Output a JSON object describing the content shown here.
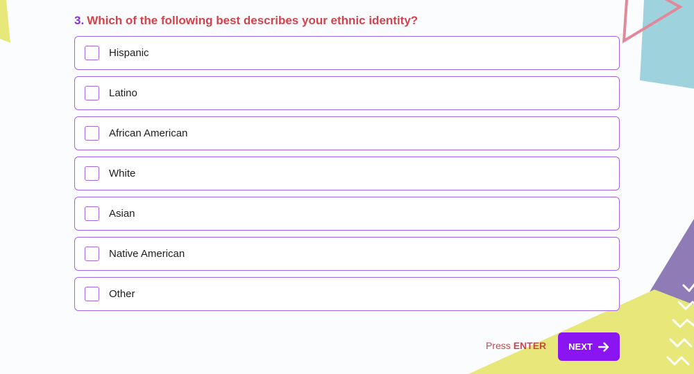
{
  "question": {
    "number": "3.",
    "text": "Which of the following best describes your ethnic identity?"
  },
  "options": [
    {
      "label": "Hispanic",
      "checked": false
    },
    {
      "label": "Latino",
      "checked": false
    },
    {
      "label": "African American",
      "checked": false
    },
    {
      "label": "White",
      "checked": false
    },
    {
      "label": "Asian",
      "checked": false
    },
    {
      "label": "Native American",
      "checked": false
    },
    {
      "label": "Other",
      "checked": false
    }
  ],
  "footer": {
    "hint_prefix": "Press",
    "hint_key": "ENTER",
    "next_label": "NEXT",
    "next_icon": "arrow-right-icon"
  },
  "colors": {
    "accent": "#8a14f2",
    "option_border": "#a464e6",
    "question_text": "#d2434c",
    "shape_yellow": "#e8e77a",
    "shape_blue": "#9ed3de",
    "shape_pink": "#e0899a",
    "shape_purple": "#8f7bb6"
  }
}
